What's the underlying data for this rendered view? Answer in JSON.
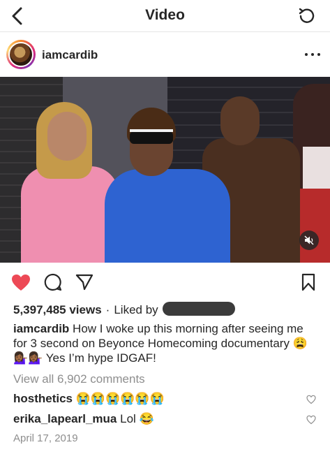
{
  "topbar": {
    "title": "Video",
    "back_icon": "chevron-left-icon",
    "refresh_icon": "refresh-icon"
  },
  "post": {
    "username": "iamcardib",
    "more_icon": "ellipsis-icon"
  },
  "video": {
    "mute_icon": "speaker-muted-icon"
  },
  "actions": {
    "like_icon": "heart-filled-icon",
    "like_color": "#ed4956",
    "comment_icon": "comment-bubble-icon",
    "share_icon": "send-icon",
    "save_icon": "bookmark-icon"
  },
  "stats": {
    "views": "5,397,485 views",
    "separator": "·",
    "liked_by": "Liked by"
  },
  "caption": {
    "user": "iamcardib",
    "text": "How I woke up this morning after seeing me for 3 second on Beyonce Homecoming documentary 😩💁🏾‍♀️💁🏾‍♀️ Yes I’m hype IDGAF!"
  },
  "view_all_comments": "View all 6,902 comments",
  "comments": [
    {
      "user": "hosthetics",
      "text": "😭😭😭😭😭😭"
    },
    {
      "user": "erika_lapearl_mua",
      "text": "Lol 😂"
    }
  ],
  "date": "April 17, 2019"
}
